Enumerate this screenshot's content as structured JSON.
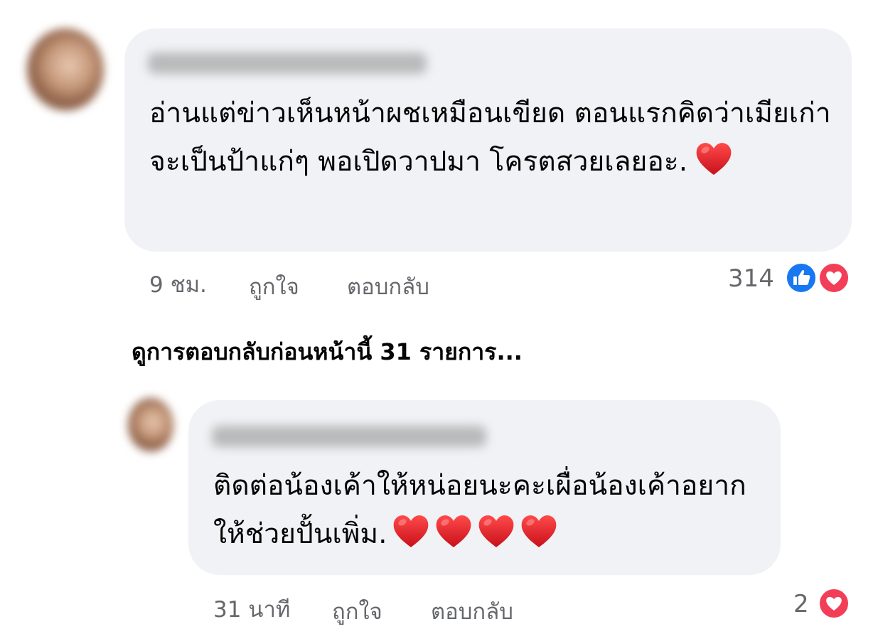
{
  "comment": {
    "text": "อ่านแต่ข่าวเห็นหน้าผชเหมือนเขียด ตอนแรกคิดว่าเมียเก่าจะเป็นป้าแก่ๆ พอเปิดวาปมา โครตสวยเลยอะ.",
    "emoji": "red-heart",
    "timestamp": "9 ชม.",
    "like_label": "ถูกใจ",
    "reply_label": "ตอบกลับ",
    "reaction_count": "314",
    "reactions": [
      "like-icon",
      "love-icon"
    ]
  },
  "view_previous_replies": "ดูการตอบกลับก่อนหน้านี้ 31 รายการ...",
  "reply": {
    "text": "ติดต่อน้องเค้าให้หน่อยนะคะเผื่อน้องเค้าอยากให้ช่วยปั้นเพิ่ม.",
    "emoji_count": 4,
    "timestamp": "31 นาที",
    "like_label": "ถูกใจ",
    "reply_label": "ตอบกลับ",
    "reaction_count": "2",
    "reactions": [
      "love-icon"
    ]
  },
  "colors": {
    "bubble": "#f0f2f5",
    "meta_text": "#65676b",
    "like_blue": "#1877f2",
    "love_red": "#f33e58",
    "heart_red": "#e0222a"
  }
}
